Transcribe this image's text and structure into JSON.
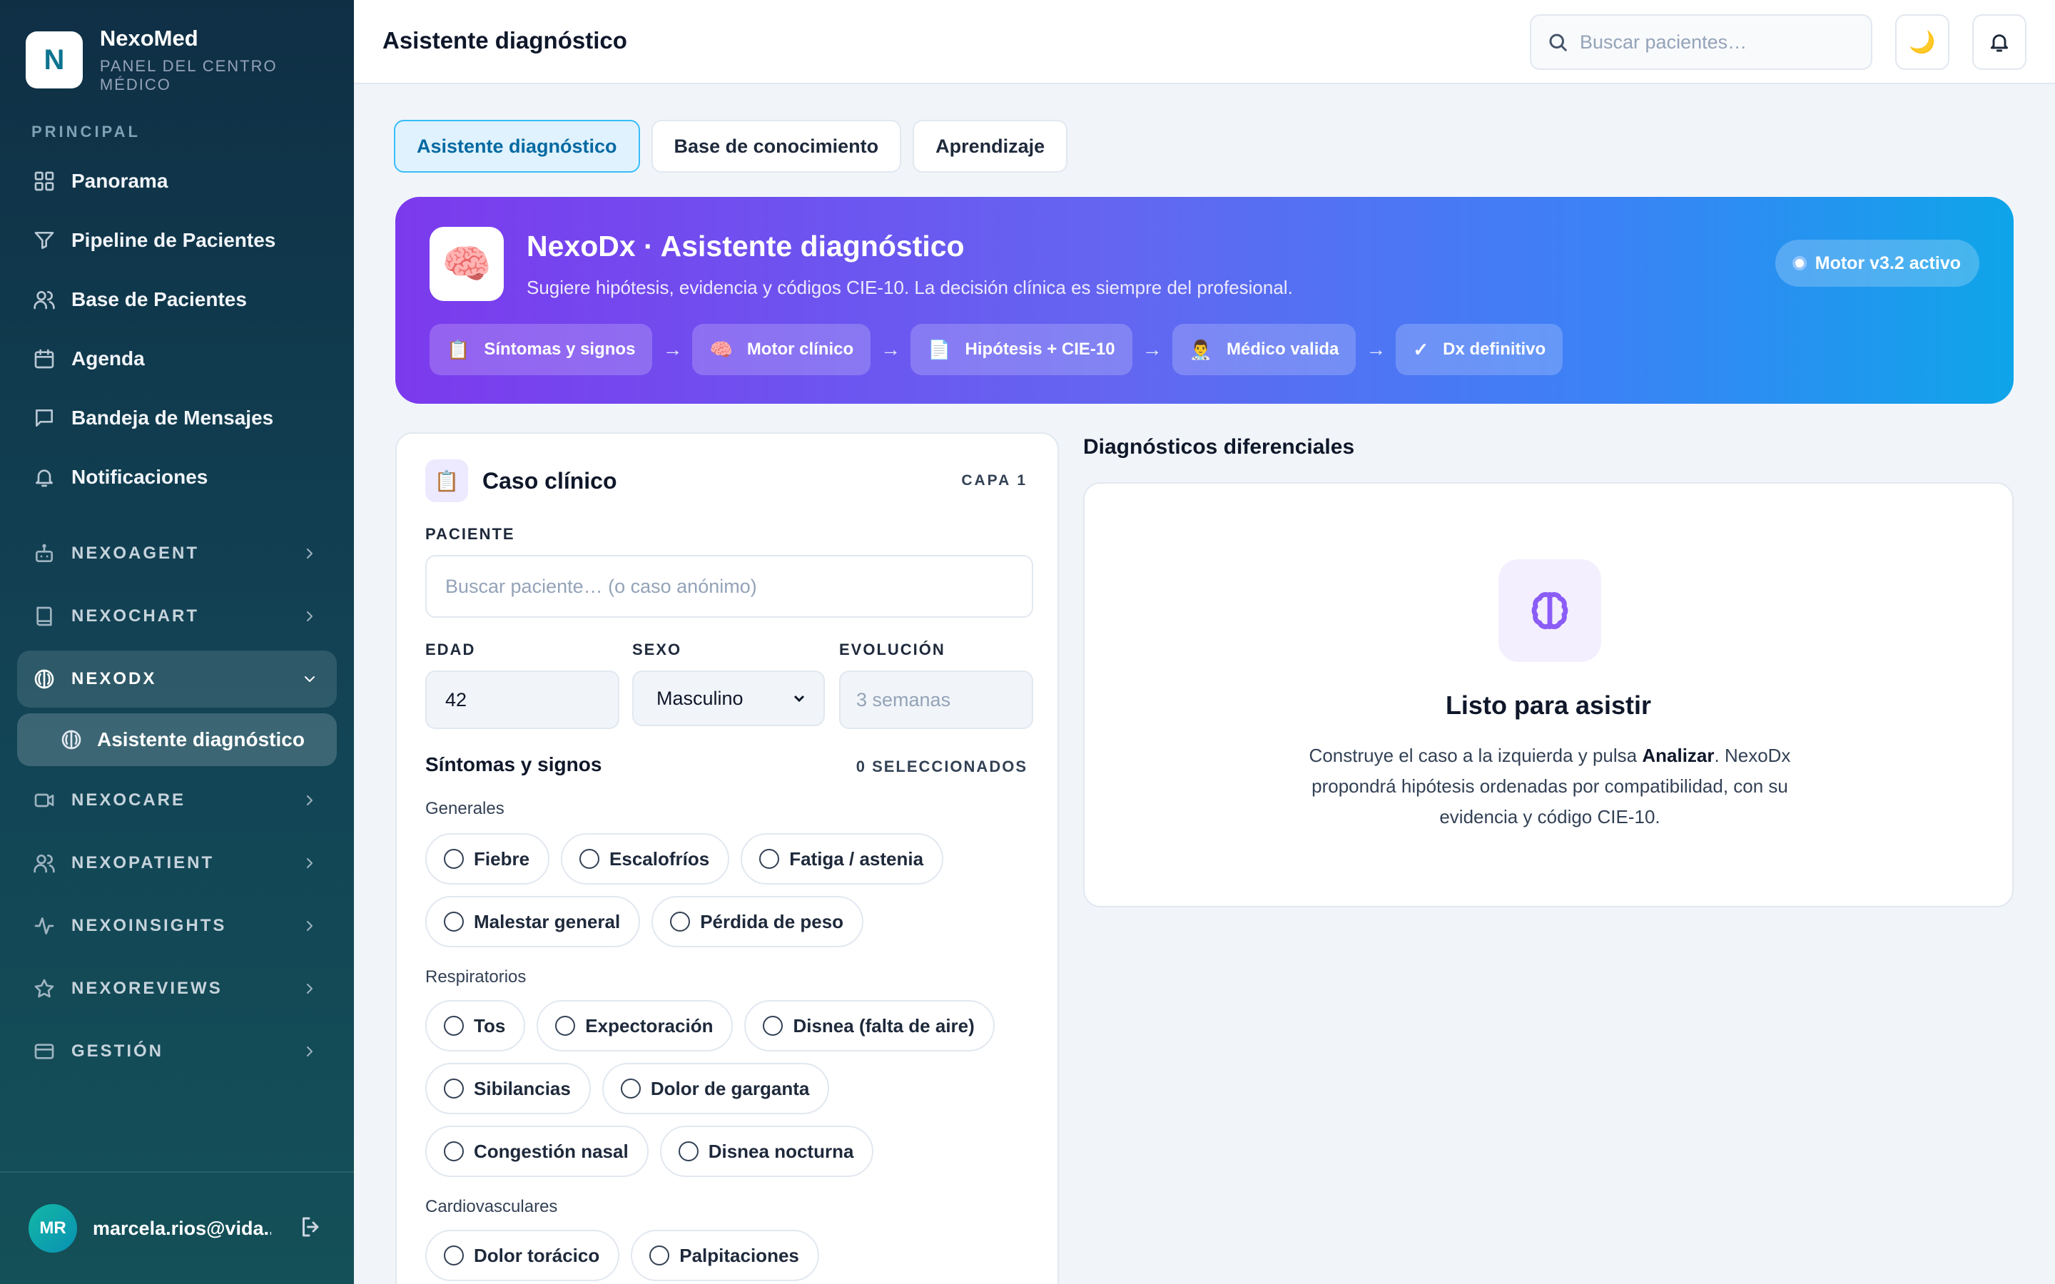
{
  "brand": {
    "logo_letter": "N",
    "name": "NexoMed",
    "subtitle": "PANEL DEL CENTRO MÉDICO"
  },
  "sidebar": {
    "section_label": "PRINCIPAL",
    "items": [
      {
        "label": "Panorama",
        "icon": "grid-icon"
      },
      {
        "label": "Pipeline de Pacientes",
        "icon": "filter-icon"
      },
      {
        "label": "Base de Pacientes",
        "icon": "users-icon"
      },
      {
        "label": "Agenda",
        "icon": "calendar-icon"
      },
      {
        "label": "Bandeja de Mensajes",
        "icon": "message-icon"
      },
      {
        "label": "Notificaciones",
        "icon": "bell-icon"
      }
    ],
    "groups": [
      {
        "label": "NEXOAGENT",
        "icon": "robot-icon"
      },
      {
        "label": "NEXOCHART",
        "icon": "book-icon"
      },
      {
        "label": "NEXODX",
        "icon": "brain-icon",
        "open": true
      },
      {
        "label": "NEXOCARE",
        "icon": "video-icon"
      },
      {
        "label": "NEXOPATIENT",
        "icon": "users-icon"
      },
      {
        "label": "NEXOINSIGHTS",
        "icon": "activity-icon"
      },
      {
        "label": "NEXOREVIEWS",
        "icon": "star-icon"
      },
      {
        "label": "GESTIÓN",
        "icon": "card-icon"
      }
    ],
    "sub_item": "Asistente diagnóstico"
  },
  "user": {
    "initials": "MR",
    "email": "marcela.rios@vida..."
  },
  "header": {
    "title": "Asistente diagnóstico",
    "search_placeholder": "Buscar pacientes…",
    "theme_icon": "🌙"
  },
  "tabs": [
    {
      "label": "Asistente diagnóstico",
      "active": true
    },
    {
      "label": "Base de conocimiento",
      "active": false
    },
    {
      "label": "Aprendizaje",
      "active": false
    }
  ],
  "hero": {
    "icon": "🧠",
    "title": "NexoDx · Asistente diagnóstico",
    "subtitle": "Sugiere hipótesis, evidencia y códigos CIE-10. La decisión clínica es siempre del profesional.",
    "badge": "Motor v3.2 activo",
    "flow": [
      {
        "emoji": "📋",
        "label": "Síntomas y signos"
      },
      {
        "emoji": "🧠",
        "label": "Motor clínico"
      },
      {
        "emoji": "📄",
        "label": "Hipótesis + CIE-10"
      },
      {
        "emoji": "👨‍⚕️",
        "label": "Médico valida"
      },
      {
        "emoji": "✓",
        "label": "Dx definitivo"
      }
    ],
    "arrow": "→"
  },
  "case": {
    "icon": "📋",
    "title": "Caso clínico",
    "layer": "CAPA 1",
    "patient_label": "PACIENTE",
    "patient_placeholder": "Buscar paciente… (o caso anónimo)",
    "age_label": "EDAD",
    "age_value": "42",
    "sex_label": "SEXO",
    "sex_value": "Masculino",
    "evolution_label": "EVOLUCIÓN",
    "evolution_placeholder": "3 semanas",
    "symptoms_title": "Síntomas y signos",
    "selected_count": "0 SELECCIONADOS",
    "categories": [
      {
        "label": "Generales",
        "items": [
          "Fiebre",
          "Escalofríos",
          "Fatiga / astenia",
          "Malestar general",
          "Pérdida de peso"
        ]
      },
      {
        "label": "Respiratorios",
        "items": [
          "Tos",
          "Expectoración",
          "Disnea (falta de aire)",
          "Sibilancias",
          "Dolor de garganta",
          "Congestión nasal",
          "Disnea nocturna"
        ]
      },
      {
        "label": "Cardiovasculares",
        "items": [
          "Dolor torácico",
          "Palpitaciones"
        ]
      }
    ]
  },
  "diagnostics": {
    "title": "Diagnósticos diferenciales",
    "ready_title": "Listo para asistir",
    "text_before": "Construye el caso a la izquierda y pulsa ",
    "text_bold": "Analizar",
    "text_after": ". NexoDx propondrá hipótesis ordenadas por compatibilidad, con su evidencia y código CIE-10."
  }
}
